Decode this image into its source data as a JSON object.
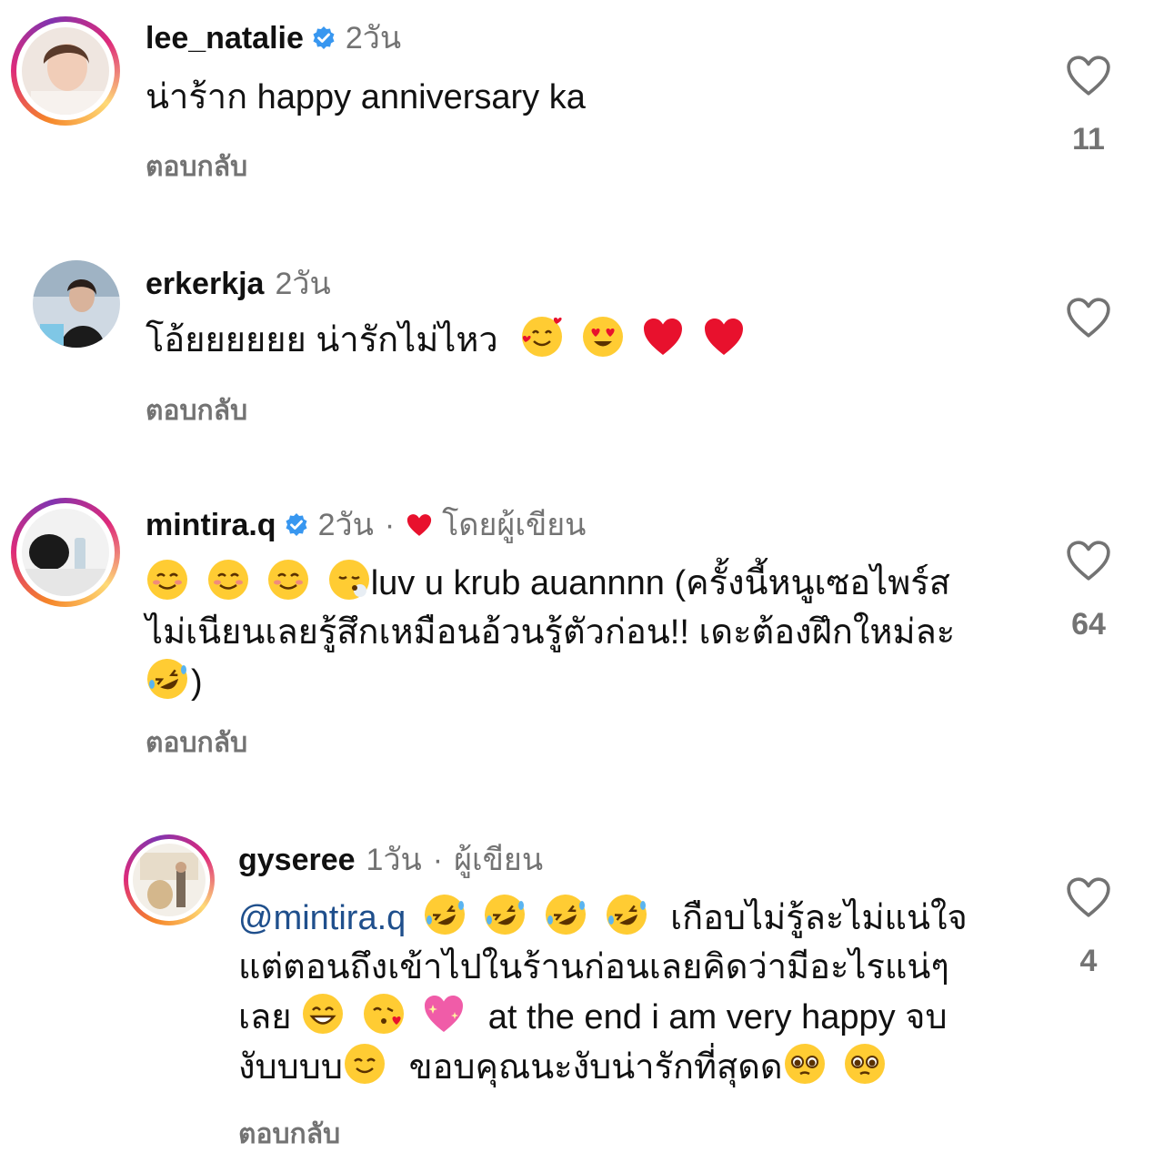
{
  "colors": {
    "meta": "#737373",
    "mention": "#1f4f8c",
    "heart": "#e8112d",
    "verified": "#3897f0"
  },
  "comments": [
    {
      "username": "lee_natalie",
      "verified": true,
      "time": "2วัน",
      "text": "น่าร้าก happy anniversary ka",
      "reply_label": "ตอบกลับ",
      "likes": "11"
    },
    {
      "username": "erkerkja",
      "verified": false,
      "time": "2วัน",
      "text": "โอ้ยยยยยย น่ารักไม่ไหว",
      "emojis": [
        "smiling-face-with-hearts",
        "heart-eyes",
        "red-heart",
        "red-heart"
      ],
      "reply_label": "ตอบกลับ",
      "likes": ""
    },
    {
      "username": "mintira.q",
      "verified": true,
      "time": "2วัน",
      "separator": "·",
      "liked_by_author_label": "โดยผู้เขียน",
      "text_line1": "luv u krub auannnn (ครั้งนี้หนูเซอไพร์ส",
      "text_line2": "ไม่เนียนเลยรู้สึกเหมือนอ้วนรู้ตัวก่อน!! เดะต้องฝึกใหม่ละ",
      "text_line3": ")",
      "reply_label": "ตอบกลับ",
      "likes": "64"
    },
    {
      "username": "gyseree",
      "verified": false,
      "time": "1วัน",
      "separator": "·",
      "author_label": "ผู้เขียน",
      "mention": "@mintira.q",
      "text_line1": "เกือบไม่รู้ละไม่แน่ใจ",
      "text_line2": "แต่ตอนถึงเข้าไปในร้านก่อนเลยคิดว่ามีอะไรแน่ๆ",
      "text_line3a": "เลย",
      "text_line3b": "at the end i am very happy จบ",
      "text_line4a": "งับบบบ",
      "text_line4b": "ขอบคุณนะงับน่ารักที่สุดด",
      "reply_label": "ตอบกลับ",
      "likes": "4"
    }
  ]
}
